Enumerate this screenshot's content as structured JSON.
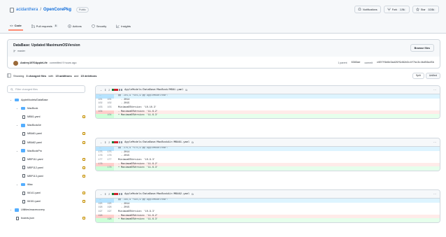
{
  "repo": {
    "owner": "acidanthera",
    "name": "OpenCorePkg",
    "visibility": "Public"
  },
  "header_actions": [
    {
      "label": "Notifications",
      "count": ""
    },
    {
      "label": "Fork",
      "count": "1.9k"
    },
    {
      "label": "Star",
      "count": "10.5k"
    }
  ],
  "tabs": [
    {
      "label": "Code",
      "count": ""
    },
    {
      "label": "Pull requests",
      "count": "8"
    },
    {
      "label": "Actions",
      "count": ""
    },
    {
      "label": "Security",
      "count": ""
    },
    {
      "label": "Insights",
      "count": ""
    }
  ],
  "commit": {
    "title": "DataBase: Updated MaximumOSVersion",
    "branch": "master",
    "browse_label": "Browse files",
    "author": "Andrey1970AppleLife",
    "authored_text": "committed 9 hours ago",
    "parent_label": "1 parent",
    "parent_sha": "6383ae",
    "commit_label": "commit",
    "commit_sha": "c607f6e8d3ad29f9d82e3c4f7bc3c4bd56a45b"
  },
  "summary": {
    "prefix": "Showing",
    "files_changed": "3 changed files",
    "with": "with",
    "additions": "15 additions",
    "and": "and",
    "deletions": "15 deletions",
    "split_label": "Split",
    "unified_label": "Unified"
  },
  "filter_placeholder": "Filter changed files",
  "tree": [
    {
      "kind": "folder",
      "depth": 0,
      "label": "AppleModels/DataBase"
    },
    {
      "kind": "folder",
      "depth": 1,
      "label": "MacBook"
    },
    {
      "kind": "file",
      "depth": 2,
      "label": "MB81.yaml"
    },
    {
      "kind": "folder",
      "depth": 1,
      "label": "MacBookAir"
    },
    {
      "kind": "file",
      "depth": 2,
      "label": "MBA81.yaml"
    },
    {
      "kind": "file",
      "depth": 2,
      "label": "MBA82.yaml"
    },
    {
      "kind": "folder",
      "depth": 1,
      "label": "MacBookPro"
    },
    {
      "kind": "file",
      "depth": 2,
      "label": "MBP111.yaml"
    },
    {
      "kind": "file",
      "depth": 2,
      "label": "MBP112.yaml"
    },
    {
      "kind": "file",
      "depth": 2,
      "label": "MBP113.yaml"
    },
    {
      "kind": "folder",
      "depth": 1,
      "label": "iMac"
    },
    {
      "kind": "file",
      "depth": 2,
      "label": "IM141.yaml"
    },
    {
      "kind": "file",
      "depth": 2,
      "label": "IM151.yaml"
    },
    {
      "kind": "folder",
      "depth": 0,
      "label": "Utilities/macrecovery"
    },
    {
      "kind": "file",
      "depth": 1,
      "label": "boards.json"
    }
  ],
  "diffs": [
    {
      "count": "2",
      "path": "AppleModels/DataBase/MacBook/MB81.yaml",
      "lines": [
        {
          "type": "hunk",
          "old": "…",
          "new": "",
          "text": "@@ -101,9 +101,9 @@ AppleModelYear:"
        },
        {
          "type": "ctx",
          "old": "101",
          "new": "101",
          "text": "  - 2014"
        },
        {
          "type": "ctx",
          "old": "102",
          "new": "102",
          "text": "  - 2015"
        },
        {
          "type": "ctx",
          "old": "103",
          "new": "103",
          "text": "MinimumOSVersion: '10.10.3'"
        },
        {
          "type": "del",
          "old": "104",
          "new": "",
          "text": "- MaximumOSVersion: '11.6.2'"
        },
        {
          "type": "add",
          "old": "",
          "new": "104",
          "text": "+ MaximumOSVersion: '11.6.3'"
        }
      ]
    },
    {
      "count": "2",
      "path": "AppleModels/DataBase/MacBookAir/MBA61.yaml",
      "lines": [
        {
          "type": "hunk",
          "old": "…",
          "new": "",
          "text": "@@ -175,9 +175,9 @@ AppleModelYear:"
        },
        {
          "type": "ctx",
          "old": "175",
          "new": "175",
          "text": "  - 2014"
        },
        {
          "type": "ctx",
          "old": "176",
          "new": "176",
          "text": "  - 2015"
        },
        {
          "type": "ctx",
          "old": "177",
          "new": "177",
          "text": "MinimumOSVersion: '10.9.3'"
        },
        {
          "type": "del",
          "old": "178",
          "new": "",
          "text": "- MaximumOSVersion: '11.6.2'"
        },
        {
          "type": "add",
          "old": "",
          "new": "178",
          "text": "+ MaximumOSVersion: '11.6.3'"
        }
      ]
    },
    {
      "count": "2",
      "path": "AppleModels/DataBase/MacBookAir/MBA62.yaml",
      "lines": [
        {
          "type": "hunk",
          "old": "…",
          "new": "",
          "text": "@@ -195,9 +195,9 @@ AppleModelYear:"
        },
        {
          "type": "ctx",
          "old": "195",
          "new": "195",
          "text": "  - 2014"
        },
        {
          "type": "ctx",
          "old": "196",
          "new": "196",
          "text": "  - 2015"
        },
        {
          "type": "ctx",
          "old": "197",
          "new": "197",
          "text": "MinimumOSVersion: '10.9.3'"
        },
        {
          "type": "del",
          "old": "198",
          "new": "",
          "text": "- MaximumOSVersion: '11.6.2'"
        },
        {
          "type": "add",
          "old": "",
          "new": "198",
          "text": "+ MaximumOSVersion: '11.6.3'"
        }
      ]
    }
  ],
  "colors": {
    "accent": "#0969da",
    "tab_underline": "#fd8c73",
    "deletion": "#ffebe9",
    "addition": "#e6ffec",
    "hunk": "#ddf4ff"
  }
}
